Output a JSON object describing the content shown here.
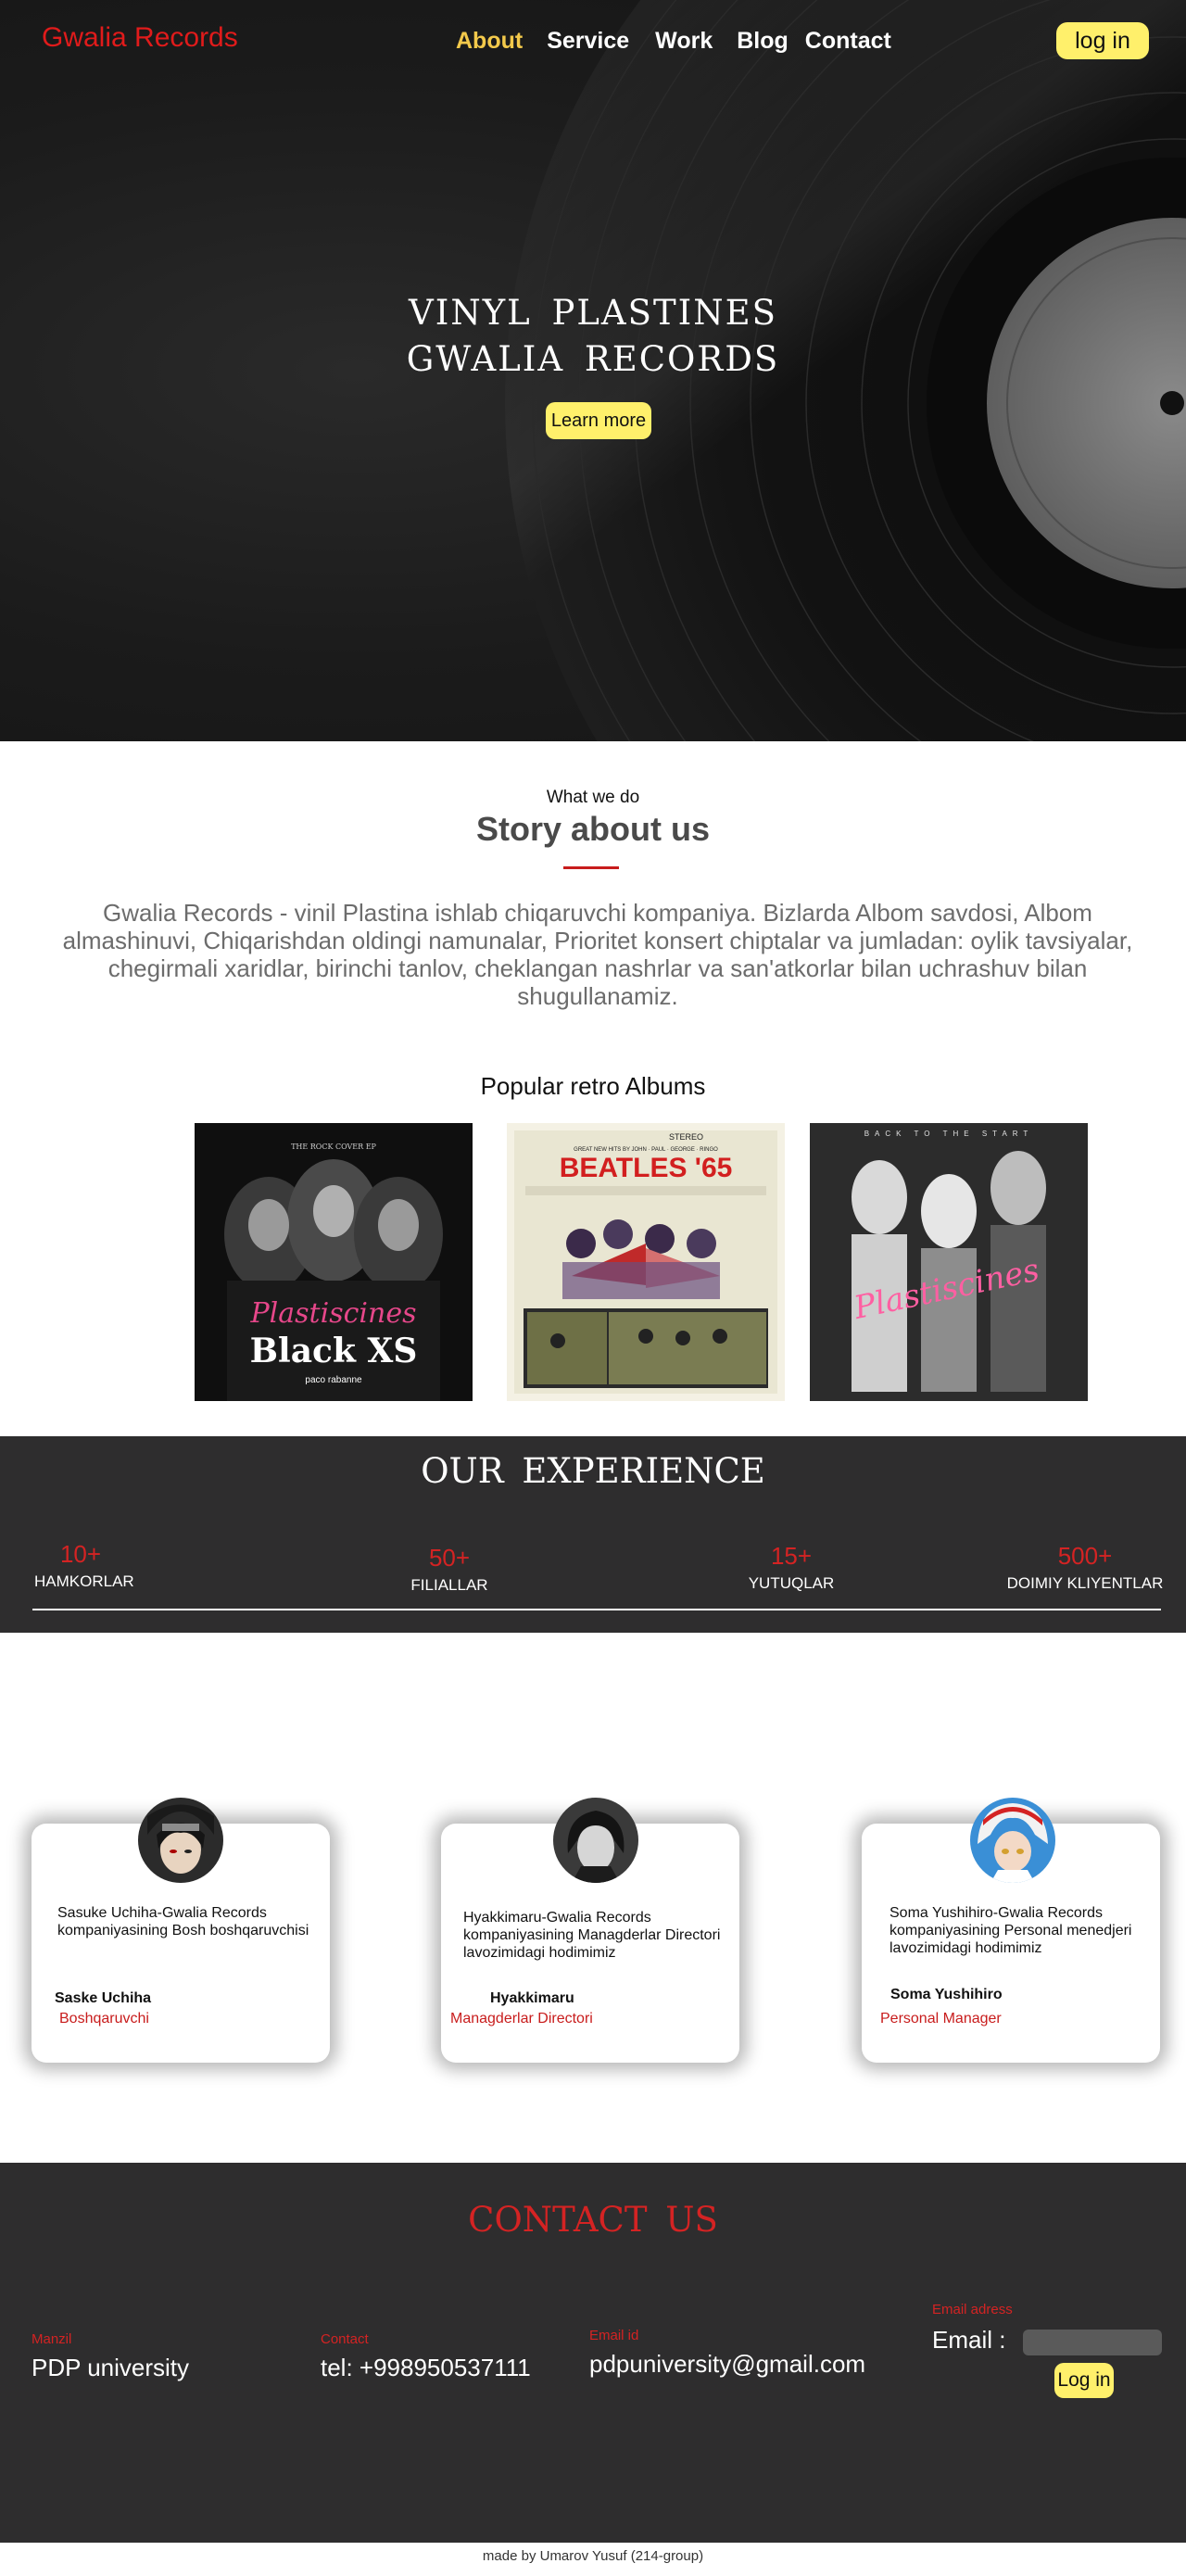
{
  "header": {
    "brand": "Gwalia Records",
    "nav": [
      "About",
      "Service",
      "Work",
      "Blog",
      "Contact"
    ],
    "active_nav": "About",
    "login_label": "log in"
  },
  "hero": {
    "title_line1": "VINYL PLASTINES",
    "title_line2": "GWALIA RECORDS",
    "button_label": "Learn more"
  },
  "story": {
    "eyebrow": "What we do",
    "title": "Story about us",
    "text": "Gwalia Records - vinil Plastina ishlab chiqaruvchi kompaniya. Bizlarda Albom savdosi, Albom almashinuvi, Chiqarishdan oldingi namunalar, Prioritet konsert chiptalar va jumladan: oylik tavsiyalar, chegirmali xaridlar, birinchi tanlov, cheklangan nashrlar va san'atkorlar bilan uchrashuv bilan shugullanamiz."
  },
  "albums": {
    "title": "Popular retro Albums",
    "items": [
      {
        "cover_text": "Plastiscines",
        "caption": "Black XS",
        "top_text": "THE ROCK COVER EP",
        "brand": "paco rabanne"
      },
      {
        "cover_text": "BEATLES '65",
        "top_text": "STEREO",
        "subtitle": "GREAT NEW HITS BY JOHN · PAUL · GEORGE · RINGO"
      },
      {
        "cover_text": "Plastiscines",
        "top_text": "BACK TO THE START"
      }
    ]
  },
  "experience": {
    "title": "OUR EXPERIENCE",
    "stats": [
      {
        "value": "10+",
        "label": "HAMKORLAR"
      },
      {
        "value": "50+",
        "label": "FILIALLAR"
      },
      {
        "value": "15+",
        "label": "YUTUQLAR"
      },
      {
        "value": "500+",
        "label": "DOIMIY KLIYENTLAR"
      }
    ]
  },
  "team": [
    {
      "desc1": "Sasuke Uchiha-Gwalia Records",
      "desc2": "kompaniyasining Bosh boshqaruvchisi",
      "desc3": "",
      "name": "Saske Uchiha",
      "role": "Boshqaruvchi"
    },
    {
      "desc1": "Hyakkimaru-Gwalia Records",
      "desc2": "kompaniyasining Managderlar Directori",
      "desc3": "lavozimidagi hodimimiz",
      "name": "Hyakkimaru",
      "role": "Managderlar Directori"
    },
    {
      "desc1": "Soma Yushihiro-Gwalia Records",
      "desc2": "kompaniyasining Personal menedjeri",
      "desc3": "lavozimidagi hodimimiz",
      "name": "Soma Yushihiro",
      "role": "Personal Manager"
    }
  ],
  "contact": {
    "title": "CONTACT US",
    "address_label": "Manzil",
    "address_value": "PDP university",
    "contact_label": "Contact",
    "contact_value": "tel: +998950537111",
    "email_label": "Email id",
    "email_value": "pdpuniversity@gmail.com",
    "email_form_label": "Email adress",
    "email_form_prompt": "Email :",
    "login_label": "Log in"
  },
  "footer": {
    "text": "made by Umarov Yusuf (214-group)"
  },
  "colors": {
    "accent_red": "#d42323",
    "button_yellow": "#fff06b",
    "dark_bg": "#2e2d2e",
    "active_nav": "#f3c94b"
  }
}
